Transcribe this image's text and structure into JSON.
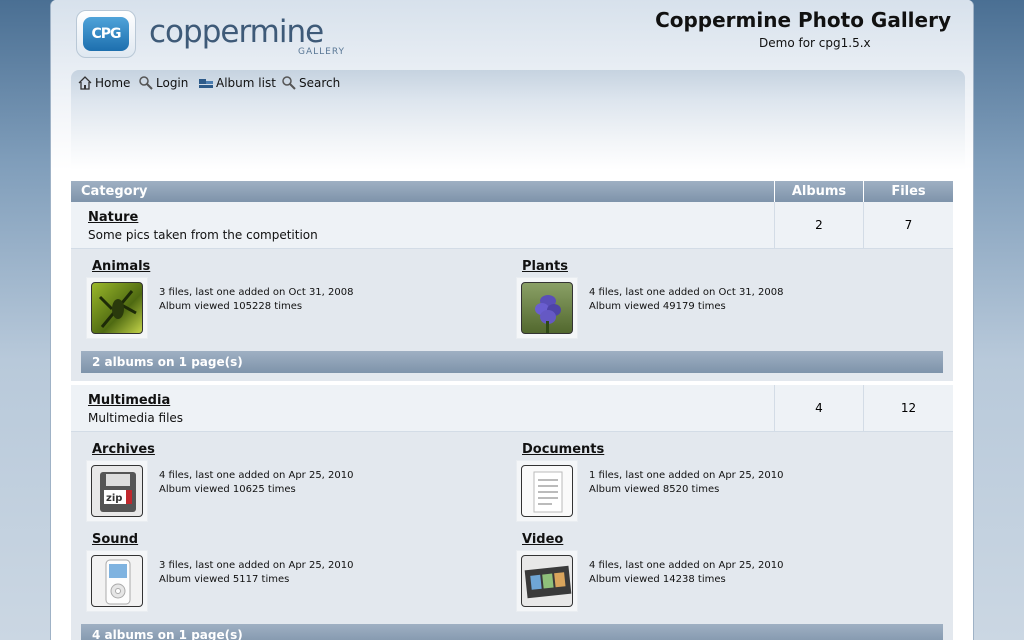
{
  "header": {
    "logo_badge": "CPG",
    "logo_word": "coppermine",
    "logo_sub": "GALLERY",
    "site_title": "Coppermine Photo Gallery",
    "site_desc": "Demo for cpg1.5.x"
  },
  "nav": [
    {
      "label": "Home",
      "icon": "home-icon"
    },
    {
      "label": "Login",
      "icon": "login-icon"
    },
    {
      "label": "Album list",
      "icon": "album-list-icon"
    },
    {
      "label": "Search",
      "icon": "search-icon"
    }
  ],
  "table": {
    "headers": {
      "category": "Category",
      "albums": "Albums",
      "files": "Files"
    },
    "categories": [
      {
        "name": "Nature",
        "description": "Some pics taken from the competition",
        "albums_count": "2",
        "files_count": "7",
        "albums": [
          {
            "name": "Animals",
            "info1": "3 files, last one added on Oct 31, 2008",
            "info2": "Album viewed 105228 times",
            "thumb": "insect-thumbnail"
          },
          {
            "name": "Plants",
            "info1": "4 files, last one added on Oct 31, 2008",
            "info2": "Album viewed 49179 times",
            "thumb": "flower-thumbnail"
          }
        ],
        "pages_text": "2 albums on 1 page(s)"
      },
      {
        "name": "Multimedia",
        "description": "Multimedia files",
        "albums_count": "4",
        "files_count": "12",
        "albums": [
          {
            "name": "Archives",
            "info1": "4 files, last one added on Apr 25, 2010",
            "info2": "Album viewed 10625 times",
            "thumb": "zip-file-icon"
          },
          {
            "name": "Documents",
            "info1": "1 files, last one added on Apr 25, 2010",
            "info2": "Album viewed 8520 times",
            "thumb": "document-icon"
          },
          {
            "name": "Sound",
            "info1": "3 files, last one added on Apr 25, 2010",
            "info2": "Album viewed 5117 times",
            "thumb": "audio-player-icon"
          },
          {
            "name": "Video",
            "info1": "4 files, last one added on Apr 25, 2010",
            "info2": "Album viewed 14238 times",
            "thumb": "film-strip-icon"
          }
        ],
        "pages_text": "4 albums on 1 page(s)"
      }
    ]
  },
  "colors": {
    "background_top": "#4a6f93",
    "table_header": "#8a9db2",
    "category_row": "#eef2f6",
    "album_box": "#e3e8ee"
  }
}
